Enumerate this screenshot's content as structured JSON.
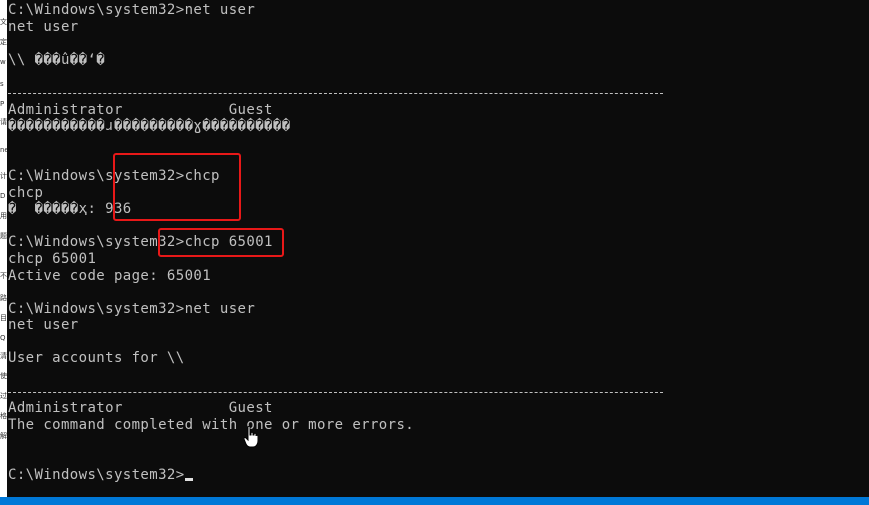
{
  "terminal": {
    "lines": [
      "C:\\Windows\\system32>net user",
      "net user",
      "",
      "\\\\ ���û��ʻ�",
      "",
      "",
      "Administrator            Guest",
      "�����������ɹ���������ɣ����������",
      "",
      "",
      "C:\\Windows\\system32>chcp",
      "chcp",
      "�  �����ҳ: 936",
      "",
      "C:\\Windows\\system32>chcp 65001",
      "chcp 65001",
      "Active code page: 65001",
      "",
      "C:\\Windows\\system32>net user",
      "net user",
      "",
      "User accounts for \\\\",
      "",
      "",
      "Administrator            Guest",
      "The command completed with one or more errors.",
      "",
      "",
      "C:\\Windows\\system32>"
    ]
  },
  "left_strip": {
    "glyphs": [
      "文",
      "定",
      "w",
      "s",
      "P",
      "请",
      "ne",
      "计",
      "D",
      "用",
      "题",
      "不",
      "路",
      "目",
      "Q",
      "清",
      "使",
      "过",
      "格",
      "解"
    ]
  },
  "colors": {
    "background": "#0c0c0c",
    "text": "#c0c0c0",
    "highlight": "#e81818",
    "taskbar": "#0078d7"
  }
}
